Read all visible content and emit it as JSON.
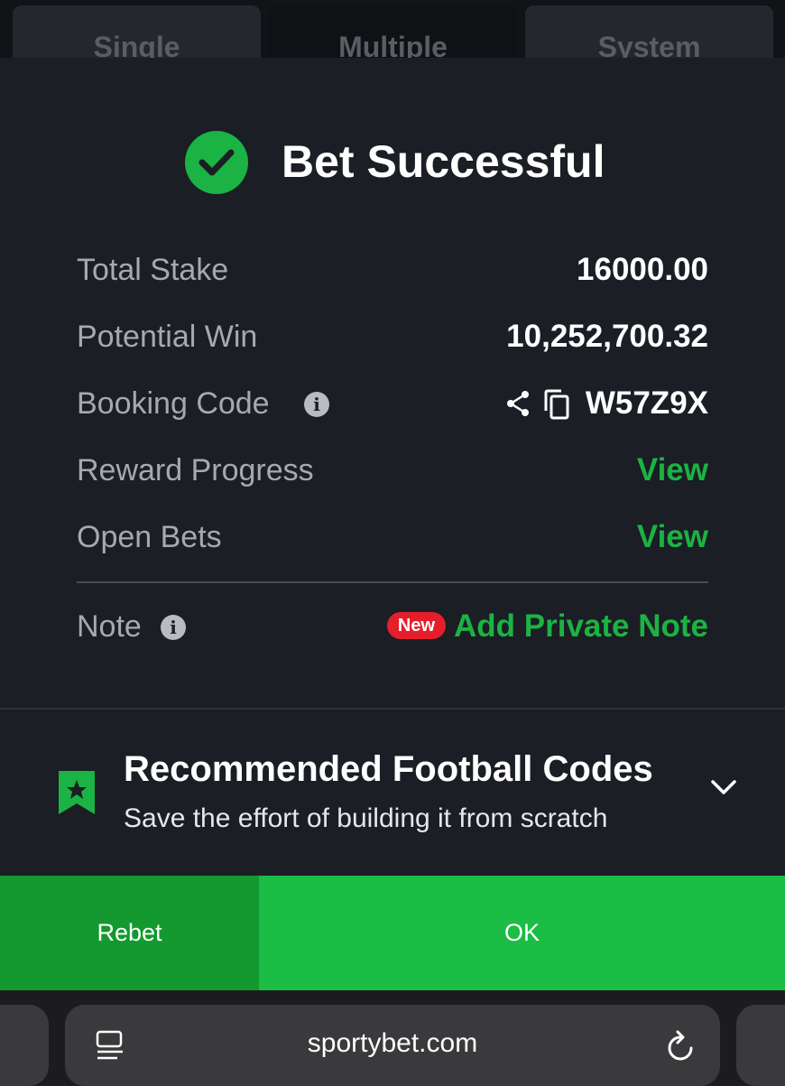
{
  "tabs": [
    "Single",
    "Multiple",
    "System"
  ],
  "header": {
    "title": "Bet Successful"
  },
  "rows": {
    "total_stake": {
      "label": "Total Stake",
      "value": "16000.00"
    },
    "potential_win": {
      "label": "Potential Win",
      "value": "10,252,700.32"
    },
    "booking_code": {
      "label": "Booking Code",
      "value": "W57Z9X"
    },
    "reward_progress": {
      "label": "Reward Progress",
      "value": "View"
    },
    "open_bets": {
      "label": "Open Bets",
      "value": "View"
    }
  },
  "note": {
    "label": "Note",
    "badge": "New",
    "action": "Add Private Note"
  },
  "recommended": {
    "title": "Recommended Football Codes",
    "subtitle": "Save the effort of building it from scratch"
  },
  "buttons": {
    "rebet": "Rebet",
    "ok": "OK"
  },
  "browser": {
    "url": "sportybet.com"
  },
  "colors": {
    "accent_green": "#1bb344",
    "badge_red": "#e41f2b",
    "background": "#1b1e24"
  },
  "icons": [
    "check-circle-icon",
    "info-icon",
    "share-icon",
    "copy-icon",
    "bookmark-star-icon",
    "chevron-down-icon",
    "reader-icon",
    "reload-icon"
  ]
}
